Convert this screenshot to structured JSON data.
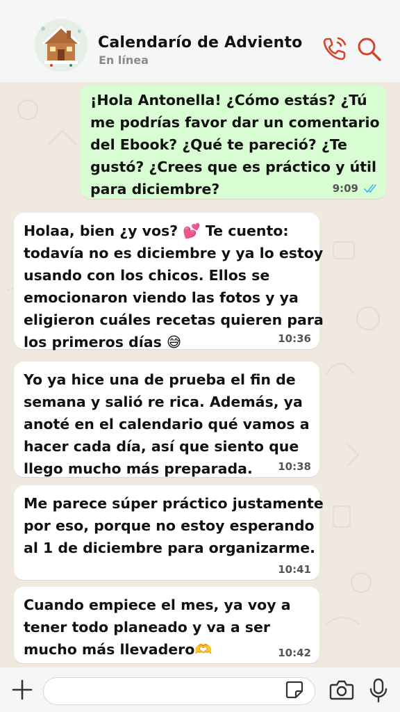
{
  "header": {
    "title": "Calendarío de Adviento",
    "status": "En línea"
  },
  "messages": [
    {
      "direction": "outgoing",
      "text": "¡Hola Antonella! ¿Cómo estás? ¿Tú\nme podrías favor dar un comentario\ndel Ebook? ¿Qué te pareció? ¿Te\ngustó? ¿Crees que es práctico y útil\npara diciembre?",
      "time": "9:09",
      "read": true
    },
    {
      "direction": "incoming",
      "text": "Holaa, bien ¿y vos? 💕 Te cuento:\ntodavía no es diciembre y ya lo estoy\nusando con los chicos. Ellos se\nemocionaron viendo las fotos y ya\neligieron cuáles recetas quieren para\nlos primeros días 😅",
      "time": "10:36"
    },
    {
      "direction": "incoming",
      "text": "Yo ya hice una de prueba el fin de\nsemana y salió re rica. Además, ya\nanoté en el calendario qué vamos a\nhacer cada día, así que siento que\nllego mucho más preparada.",
      "time": "10:38"
    },
    {
      "direction": "incoming",
      "text": "Me parece súper práctico justamente\npor eso, porque no estoy esperando\nal 1 de diciembre para organizarme.",
      "time": "10:41"
    },
    {
      "direction": "incoming",
      "text": "Cuando empiece el mes, ya voy a\ntener todo planeado y va a ser\nmucho más llevadero🫶",
      "time": "10:42"
    }
  ],
  "icons": {
    "call": "phone-call-icon",
    "search": "search-icon",
    "plus": "plus-icon",
    "sticker": "sticker-icon",
    "camera": "camera-icon",
    "mic": "microphone-icon"
  },
  "colors": {
    "accent": "#d2452a",
    "outgoing_bubble": "#d8fdd2",
    "incoming_bubble": "#ffffff",
    "chat_background": "#efe9df",
    "read_ticks": "#4fb6ec"
  }
}
